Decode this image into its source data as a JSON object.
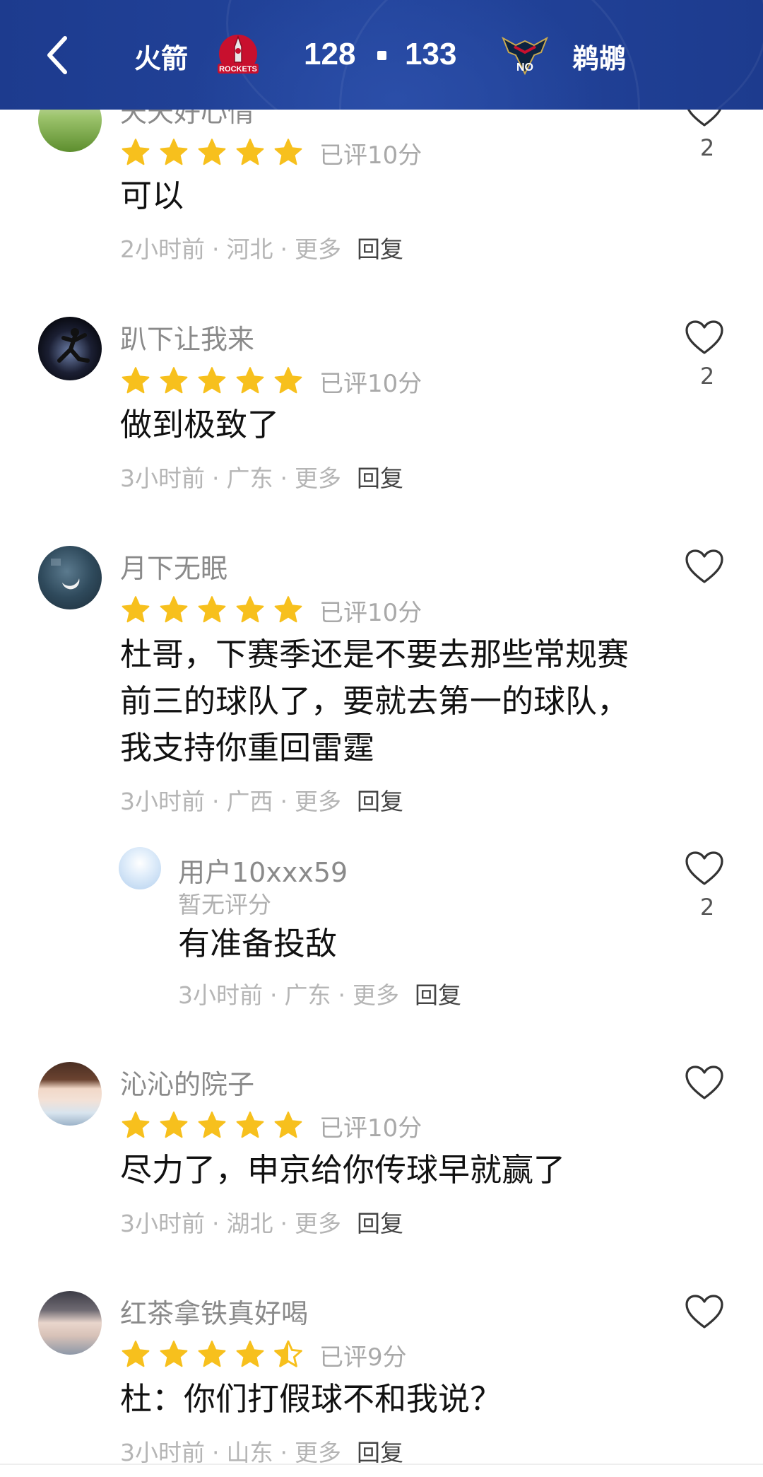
{
  "header": {
    "home_team": "火箭",
    "home_score": "128",
    "away_score": "133",
    "away_team": "鹈鹕",
    "home_logo_text": "ROCKETS",
    "away_logo_text": "NO",
    "colors": {
      "header_bg": "#23459d",
      "star": "#f7c01d"
    }
  },
  "comments": [
    {
      "username": "天天好心情",
      "rating_text": "已评10分",
      "stars": 5,
      "text": "可以",
      "time": "2小时前",
      "location": "河北",
      "more": "更多",
      "reply": "回复",
      "likes": "2"
    },
    {
      "username": "趴下让我来",
      "rating_text": "已评10分",
      "stars": 5,
      "text": "做到极致了",
      "time": "3小时前",
      "location": "广东",
      "more": "更多",
      "reply": "回复",
      "likes": "2"
    },
    {
      "username": "月下无眠",
      "rating_text": "已评10分",
      "stars": 5,
      "text_lines": [
        "杜哥，下赛季还是不要去那些常规赛",
        "前三的球队了，要就去第一的球队，",
        "我支持你重回雷霆"
      ],
      "time": "3小时前",
      "location": "广西",
      "more": "更多",
      "reply": "回复",
      "likes": ""
    },
    {
      "username": "用户10xxx59",
      "rating_text": "暂无评分",
      "text": "有准备投敌",
      "time": "3小时前",
      "location": "广东",
      "more": "更多",
      "reply": "回复",
      "likes": "2"
    },
    {
      "username": "沁沁的院子",
      "rating_text": "已评10分",
      "stars": 5,
      "text": "尽力了，申京给你传球早就赢了",
      "time": "3小时前",
      "location": "湖北",
      "more": "更多",
      "reply": "回复",
      "likes": ""
    },
    {
      "username": "红茶拿铁真好喝",
      "rating_text": "已评9分",
      "stars": 4.5,
      "text": "杜：你们打假球不和我说？",
      "time": "3小时前",
      "location": "山东",
      "more": "更多",
      "reply": "回复",
      "likes": ""
    }
  ],
  "separator": "·"
}
